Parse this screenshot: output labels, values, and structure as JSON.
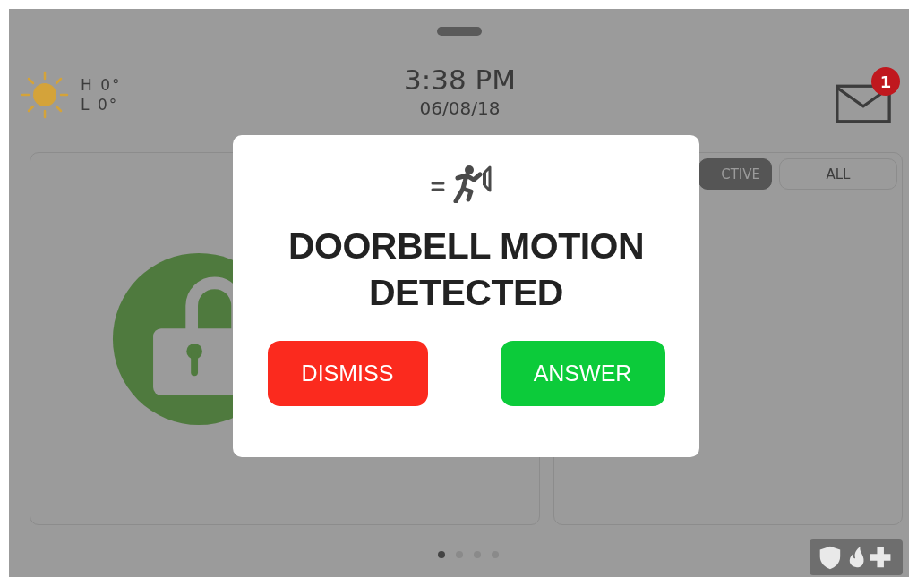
{
  "weather": {
    "high": "H 0°",
    "low": "L 0°"
  },
  "clock": {
    "time": "3:38 PM",
    "date": "06/08/18"
  },
  "messages": {
    "badge": "1"
  },
  "tabs": [
    {
      "label": "CTIVE",
      "selected": true
    },
    {
      "label": "ALL",
      "selected": false
    }
  ],
  "page_dots": [
    {
      "selected": true
    },
    {
      "selected": false
    },
    {
      "selected": false
    },
    {
      "selected": false
    }
  ],
  "alert": {
    "title": "DOORBELL MOTION DETECTED",
    "buttons": [
      {
        "label": "DISMISS",
        "kind": "dismiss"
      },
      {
        "label": "ANSWER",
        "kind": "answer"
      }
    ]
  }
}
